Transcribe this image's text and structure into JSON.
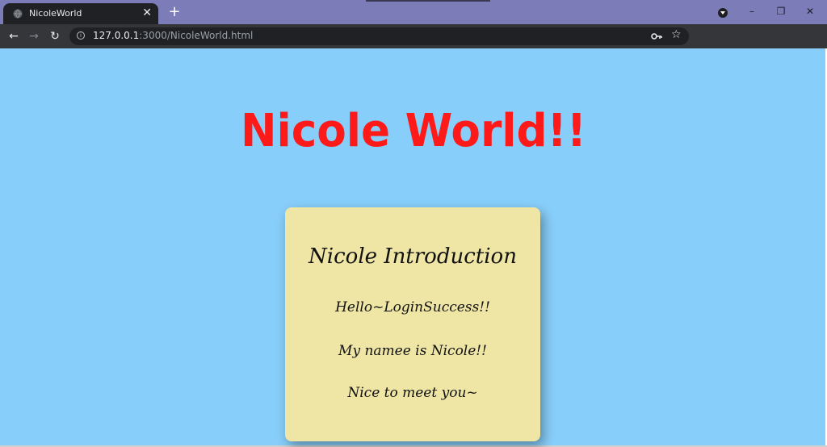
{
  "browser": {
    "tab_title": "NicoleWorld",
    "tab_close": "✕",
    "new_tab": "+",
    "url_host": "127.0.0.1",
    "url_path": ":3000/NicoleWorld.html",
    "window_controls": {
      "minimize": "–",
      "restore": "❐",
      "close": "✕"
    },
    "nav": {
      "back": "←",
      "forward": "→",
      "reload": "↻"
    },
    "icons": {
      "key": "key-icon",
      "star": "☆"
    }
  },
  "page": {
    "title": "Nicole World!!",
    "card": {
      "heading": "Nicole Introduction",
      "lines": [
        "Hello~LoginSuccess!!",
        "My namee is Nicole!!",
        "Nice to meet you~"
      ]
    }
  },
  "colors": {
    "background": "#87cefa",
    "title": "#ff1a1a",
    "card": "#efe6a6",
    "titlebar": "#7c7cb8",
    "toolbar": "#35363a"
  }
}
